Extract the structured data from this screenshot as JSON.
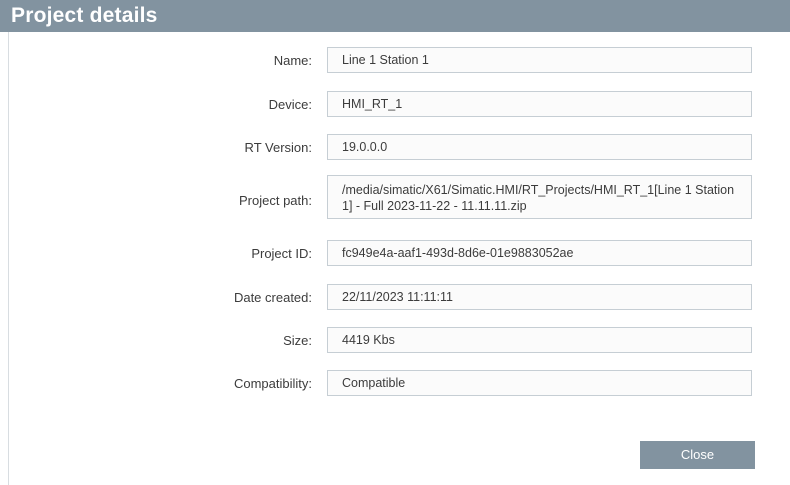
{
  "dialog": {
    "title": "Project details",
    "close_label": "Close"
  },
  "fields": [
    {
      "label": "Name:",
      "value": "Line 1 Station 1"
    },
    {
      "label": "Device:",
      "value": "HMI_RT_1"
    },
    {
      "label": "RT Version:",
      "value": "19.0.0.0"
    },
    {
      "label": "Project path:",
      "value": "/media/simatic/X61/Simatic.HMI/RT_Projects/HMI_RT_1[Line 1 Station 1] - Full 2023-11-22 - 11.11.11.zip"
    },
    {
      "label": "Project ID:",
      "value": "fc949e4a-aaf1-493d-8d6e-01e9883052ae"
    },
    {
      "label": "Date created:",
      "value": "22/11/2023 11:11:11"
    },
    {
      "label": "Size:",
      "value": "4419 Kbs"
    },
    {
      "label": "Compatibility:",
      "value": "Compatible"
    }
  ],
  "colors": {
    "header": "#8293a0",
    "button": "#8293a0",
    "field_border": "#c6ced4"
  }
}
